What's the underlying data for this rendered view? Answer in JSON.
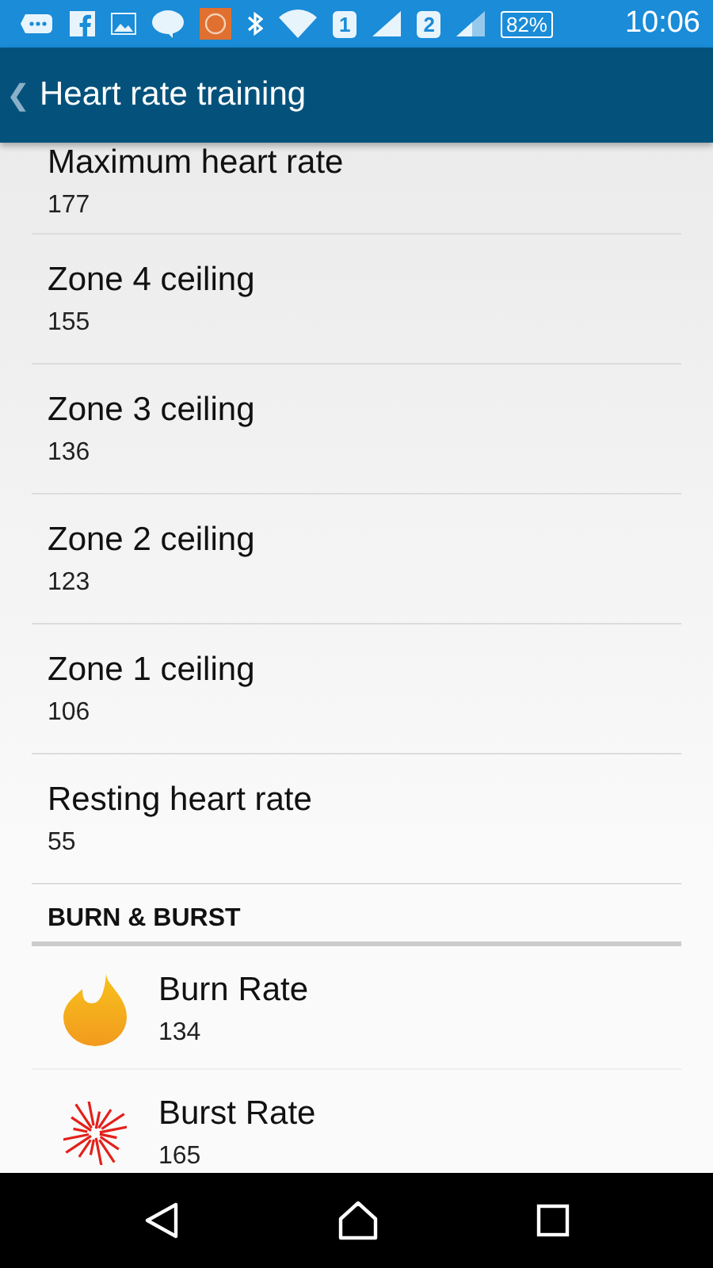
{
  "status_bar": {
    "sim_1": "1",
    "sim_2": "2",
    "battery": "82%",
    "time": "10:06"
  },
  "app_bar": {
    "back": "❮",
    "title": "Heart rate training"
  },
  "settings": [
    {
      "title": "Maximum heart rate",
      "value": "177"
    },
    {
      "title": "Zone 4 ceiling",
      "value": "155"
    },
    {
      "title": "Zone 3 ceiling",
      "value": "136"
    },
    {
      "title": "Zone 2 ceiling",
      "value": "123"
    },
    {
      "title": "Zone 1 ceiling",
      "value": "106"
    },
    {
      "title": "Resting heart rate",
      "value": "55"
    }
  ],
  "section": {
    "heading": "BURN & BURST",
    "items": [
      {
        "kind": "burn",
        "title": "Burn Rate",
        "value": "134"
      },
      {
        "kind": "burst",
        "title": "Burst Rate",
        "value": "165"
      }
    ]
  }
}
